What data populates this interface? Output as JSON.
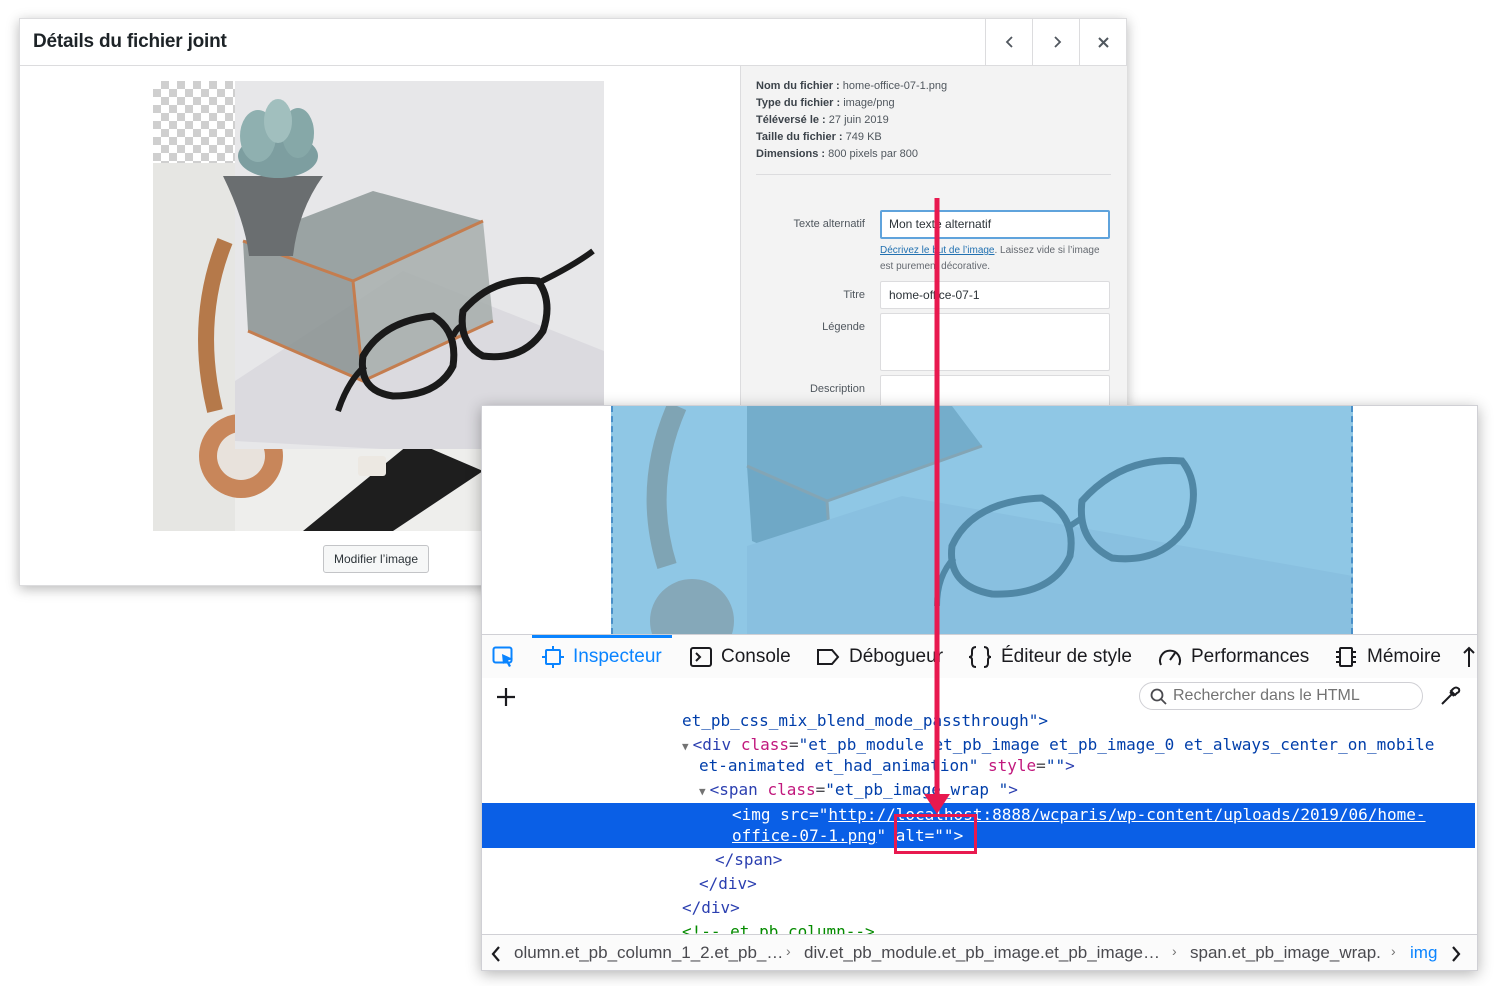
{
  "wp_modal": {
    "title": "Détails du fichier joint",
    "nav": {
      "prev_icon": "chevron-left-icon",
      "next_icon": "chevron-right-icon",
      "close_icon": "close-icon"
    },
    "edit_image_button": "Modifier l’image",
    "file_info": [
      {
        "label": "Nom du fichier :",
        "value": "home-office-07-1.png"
      },
      {
        "label": "Type du fichier :",
        "value": "image/png"
      },
      {
        "label": "Téléversé le :",
        "value": "27 juin 2019"
      },
      {
        "label": "Taille du fichier :",
        "value": "749 KB"
      },
      {
        "label": "Dimensions :",
        "value": "800 pixels par 800"
      }
    ],
    "fields": {
      "alt_label": "Texte alternatif",
      "alt_value": "Mon texte alternatif",
      "help_link": "Décrivez le but de l’image",
      "help_text": ". Laissez vide si l’image est purement décorative.",
      "title_label": "Titre",
      "title_value": "home-office-07-1",
      "caption_label": "Légende",
      "caption_value": "",
      "description_label": "Description",
      "description_value": ""
    }
  },
  "devtools": {
    "tabs": [
      "Inspecteur",
      "Console",
      "Débogueur",
      "Éditeur de style",
      "Performances",
      "Mémoire"
    ],
    "search_placeholder": "Rechercher dans le HTML",
    "code": {
      "line1": "et_pb_css_mix_blend_mode_passthrough\">",
      "line2_tag": "div",
      "line2_attr": "class",
      "line2_val": "\"et_pb_module et_pb_image et_pb_image_0 et_always_center_on_mobile",
      "line3_val": "et-animated et_had_animation\"",
      "line3_attr": "style",
      "line3_sval": "\"\"",
      "line4_tag": "span",
      "line4_attr": "class",
      "line4_val": "\"et_pb_image_wrap \"",
      "sel_line1_pre": "<img src=\"",
      "sel_url1": "http://localhost:8888/wcparis/wp-content/uploads/2019/06/home-",
      "sel_url2": "office-07-1.png",
      "sel_line2_post": "\" alt=\"\">",
      "close_span": "span",
      "close_div1": "div",
      "close_div2": "div",
      "comment": "<!--.et_pb_column-->"
    },
    "breadcrumbs": [
      "olumn.et_pb_column_1_2.et_pb_…",
      "div.et_pb_module.et_pb_image.et_pb_image…",
      "span.et_pb_image_wrap.",
      "img"
    ]
  },
  "colors": {
    "accent": "#0a84ff",
    "selection": "#0a5fe6",
    "annotation": "#e8194f",
    "overlay": "#68b6e1"
  }
}
